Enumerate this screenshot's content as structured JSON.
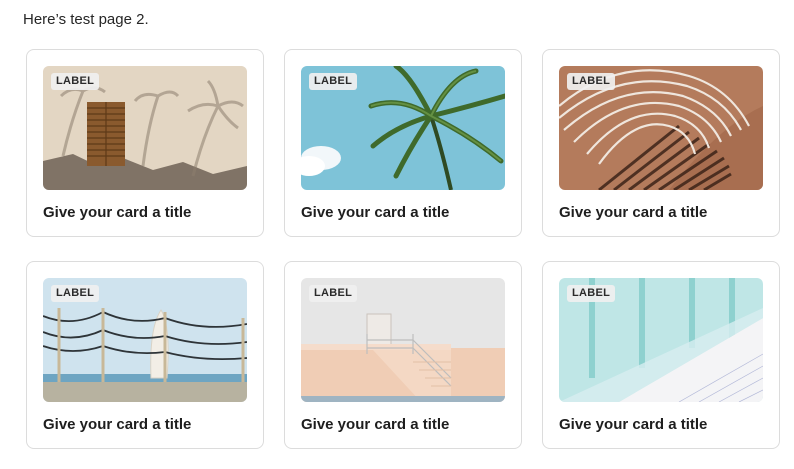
{
  "intro_text": "Here’s test page 2.",
  "cards": [
    {
      "label": "LABEL",
      "title": "Give your card a title",
      "image": "shuttered-window-palm-shadows"
    },
    {
      "label": "LABEL",
      "title": "Give your card a title",
      "image": "palm-tree-sky"
    },
    {
      "label": "LABEL",
      "title": "Give your card a title",
      "image": "curved-wire-chair-shadow"
    },
    {
      "label": "LABEL",
      "title": "Give your card a title",
      "image": "rope-fence-surfboard-beach"
    },
    {
      "label": "LABEL",
      "title": "Give your card a title",
      "image": "pastel-staircase-building"
    },
    {
      "label": "LABEL",
      "title": "Give your card a title",
      "image": "mosaic-pool-tiles"
    }
  ]
}
